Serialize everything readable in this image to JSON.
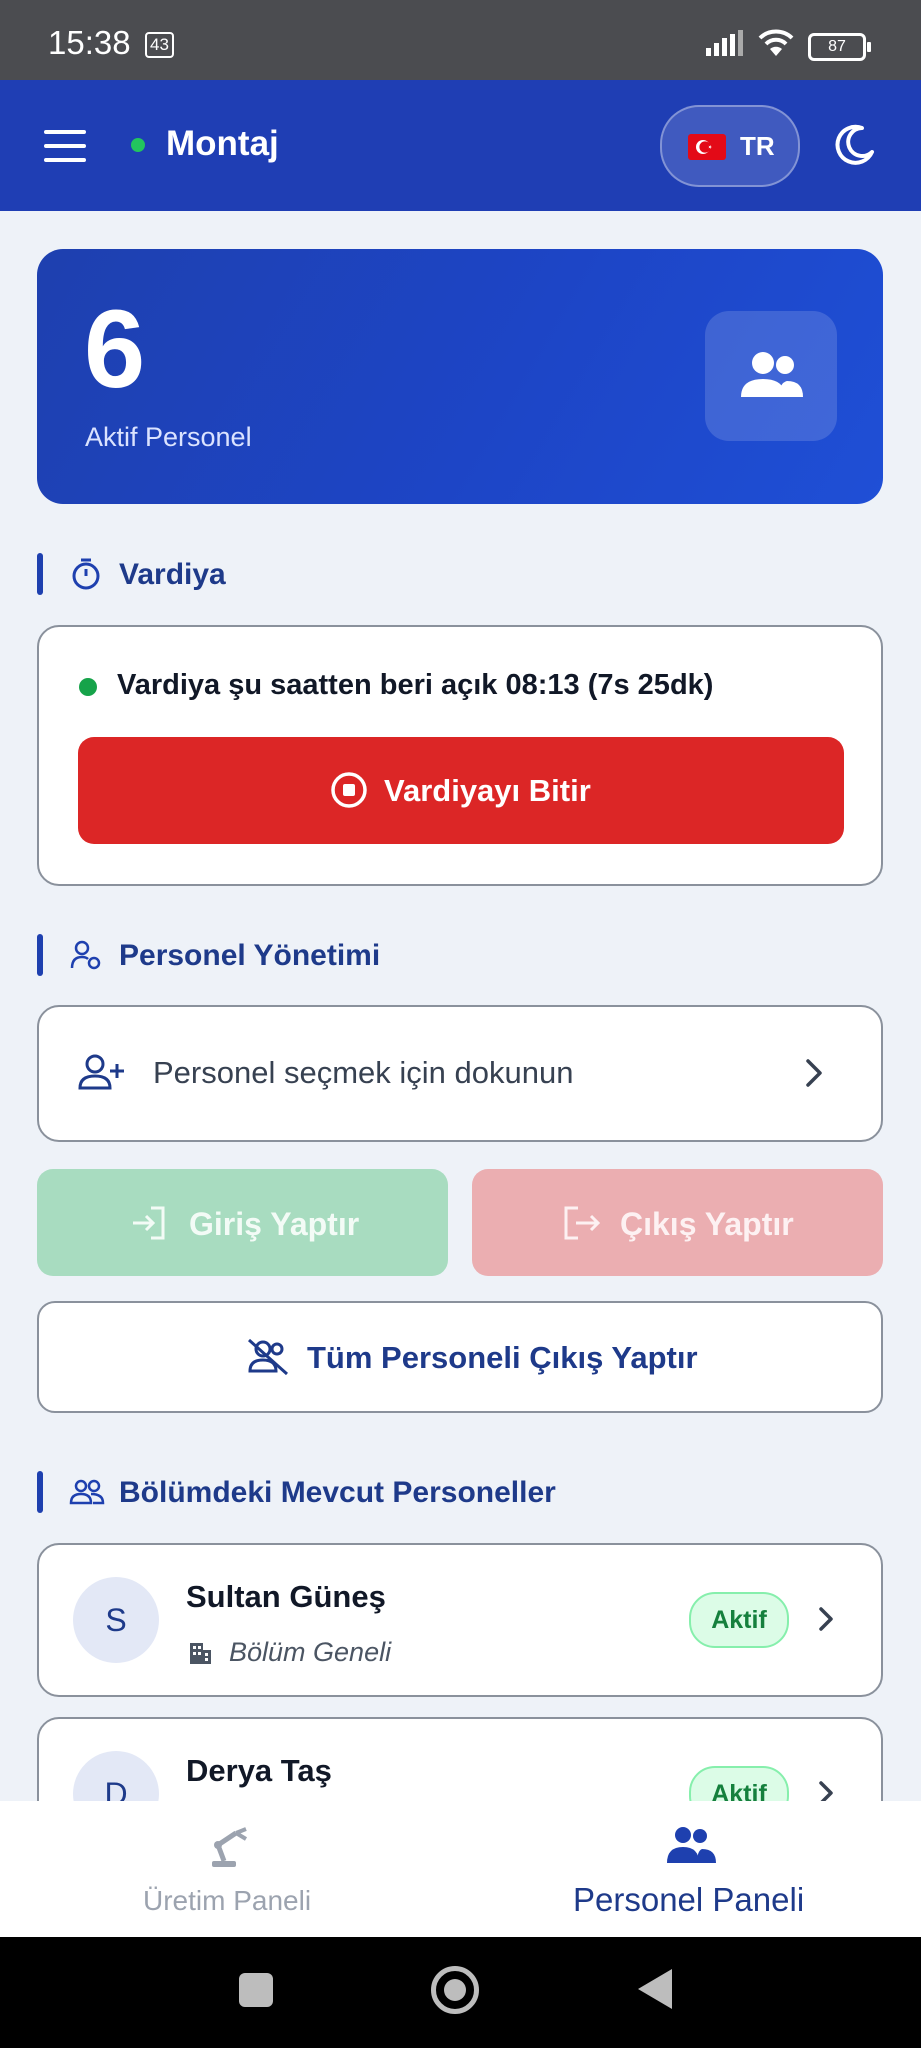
{
  "status_bar": {
    "time": "15:38",
    "notification_count": "43",
    "battery": "87"
  },
  "app_bar": {
    "title": "Montaj",
    "language": "TR",
    "status_color": "#22c55e"
  },
  "summary": {
    "count": "6",
    "label": "Aktif Personel"
  },
  "shift_section": {
    "title": "Vardiya",
    "status_text": "Vardiya şu saatten beri açık 08:13 (7s 25dk)",
    "end_button": "Vardiyayı Bitir"
  },
  "staff_section": {
    "title": "Personel Yönetimi",
    "select_placeholder": "Personel seçmek için dokunun",
    "checkin_button": "Giriş Yaptır",
    "checkout_button": "Çıkış Yaptır",
    "checkout_all_button": "Tüm Personeli Çıkış Yaptır"
  },
  "list_section": {
    "title": "Bölümdeki Mevcut Personeller",
    "items": [
      {
        "initial": "S",
        "name": "Sultan Güneş",
        "department": "Bölüm Geneli",
        "status": "Aktif"
      },
      {
        "initial": "D",
        "name": "Derya Taş",
        "department": "",
        "status": "Aktif"
      }
    ]
  },
  "bottom_nav": {
    "items": [
      {
        "label": "Üretim Paneli",
        "icon": "robot-arm-icon",
        "active": false
      },
      {
        "label": "Personel Paneli",
        "icon": "users-icon",
        "active": true
      }
    ]
  },
  "colors": {
    "primary": "#1e40af",
    "danger": "#dc2626",
    "success": "#16a34a"
  }
}
